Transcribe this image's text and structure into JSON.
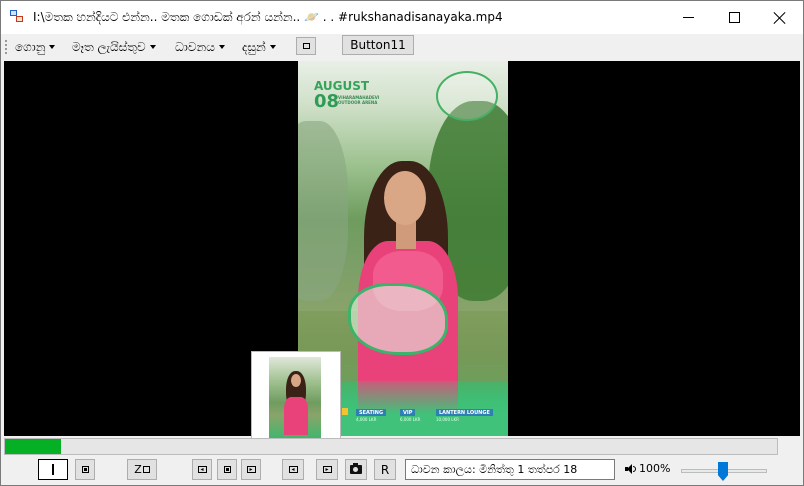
{
  "window": {
    "title": "I:\\මතක හන්දියට එන්න.. මතක ගොඩක් අරන් යන්න.. 🪐 . . #rukshanadisanayaka.mp4",
    "icon": "app-window-icon",
    "controls": [
      "minimize-icon",
      "maximize-icon",
      "close-icon"
    ]
  },
  "menu": {
    "items": [
      {
        "label": "ගොනු"
      },
      {
        "label": "මෑත ලැයිස්තුව"
      },
      {
        "label": "ධාවනය"
      },
      {
        "label": "දසුන්"
      }
    ],
    "button11_label": "Button11"
  },
  "video": {
    "poster": {
      "month": "AUGUST",
      "day": "08",
      "venue": "VIHARAMAHADEVI OUTDOOR ARENA",
      "tiers": [
        "SEATING",
        "VIP",
        "LANTERN LOUNGE"
      ],
      "prices": [
        "4,000 LKR",
        "6,000 LKR",
        "10,000 LKR"
      ]
    }
  },
  "playback": {
    "progress_fraction": 0.072,
    "progress_color": "#06b025",
    "z_label": "Z",
    "r_label": "R",
    "time_text": "ධාවන කාලය: මිනිත්තු 1 තත්පර 18",
    "volume_label": "100%",
    "volume_fraction": 0.5,
    "accent_color": "#0078d7"
  }
}
